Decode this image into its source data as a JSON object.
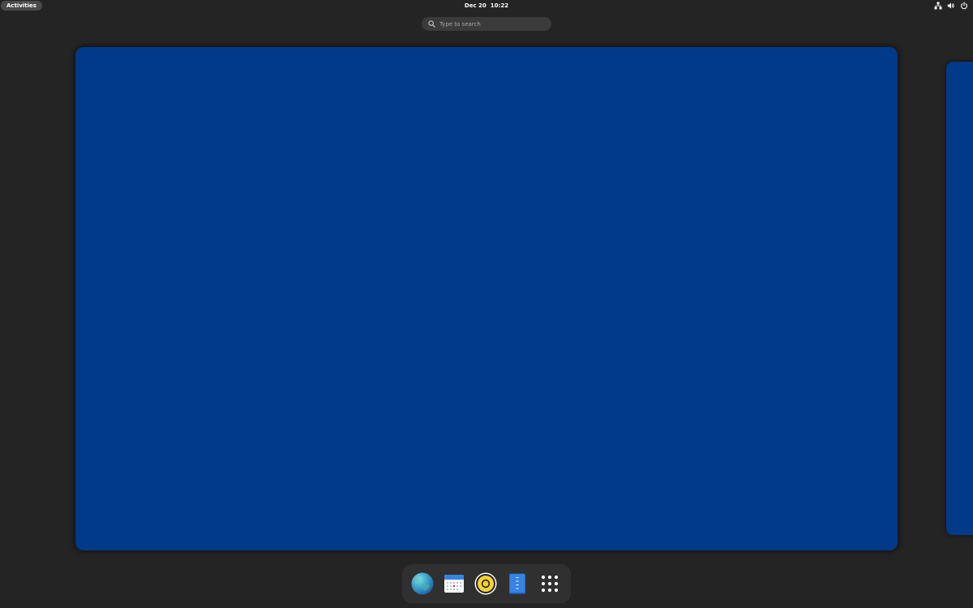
{
  "colors": {
    "background": "#242424",
    "workspace_wallpaper": "#003a88",
    "dash_background": "#303030",
    "search_background": "#3b3b3b"
  },
  "topbar": {
    "activities_label": "Activities",
    "clock": {
      "date": "Dec 20",
      "time": "10:22"
    },
    "systray_icons": [
      "network-wired-icon",
      "volume-icon",
      "power-icon"
    ]
  },
  "search": {
    "placeholder": "Type to search",
    "icon": "search-icon"
  },
  "workspaces": [
    {
      "name": "workspace-1",
      "state": "active"
    },
    {
      "name": "workspace-2",
      "state": "partial"
    }
  ],
  "dash": {
    "apps": [
      {
        "icon": "web-browser-icon",
        "name": "Web Browser"
      },
      {
        "icon": "calendar-icon",
        "name": "Calendar"
      },
      {
        "icon": "music-player-icon",
        "name": "Music Player"
      },
      {
        "icon": "text-editor-icon",
        "name": "Text Editor"
      }
    ],
    "show_apps_icon": "app-grid-icon"
  }
}
